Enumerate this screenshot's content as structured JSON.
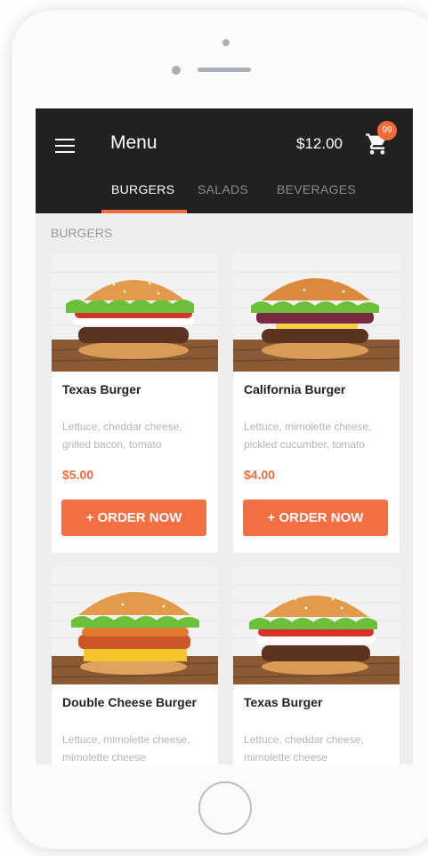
{
  "app": {
    "title": "Menu",
    "cart_total": "$12.00",
    "cart_count": "99",
    "accent_color": "#f26b3a"
  },
  "tabs": [
    {
      "label": "BURGERS",
      "active": true
    },
    {
      "label": "SALADS",
      "active": false
    },
    {
      "label": "BEVERAGES",
      "active": false
    }
  ],
  "section": {
    "label": "BURGERS"
  },
  "items": [
    {
      "name": "Texas Burger",
      "description": "Lettuce, cheddar cheese, grilled bacon, tomato",
      "price": "$5.00",
      "cta": "+ ORDER NOW"
    },
    {
      "name": "California Burger",
      "description": "Lettuce, mimolette cheese, pickled cucumber, tomato",
      "price": "$4.00",
      "cta": "+ ORDER NOW"
    },
    {
      "name": "Double Cheese Burger",
      "description": "Lettuce, mimolette cheese, mimolette cheese"
    },
    {
      "name": "Texas Burger",
      "description": "Lettuce, cheddar cheese, mimolette cheese"
    }
  ],
  "icons": {
    "menu": "hamburger-menu-icon",
    "cart": "shopping-cart-icon"
  }
}
